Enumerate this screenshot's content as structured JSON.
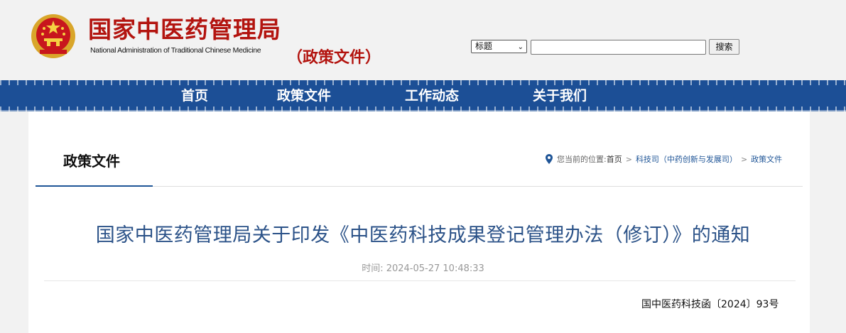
{
  "header": {
    "site_name_cn": "国家中医药管理局",
    "site_name_en": "National Administration of Traditional Chinese Medicine",
    "section_subtitle": "（政策文件）",
    "emblem_icon": "national-emblem-icon",
    "brand_color": "#b3140f"
  },
  "search": {
    "select_value": "标题",
    "input_value": "",
    "button_label": "搜索"
  },
  "nav": {
    "color": "#1c4f96",
    "items": [
      {
        "label": "首页"
      },
      {
        "label": "政策文件"
      },
      {
        "label": "工作动态"
      },
      {
        "label": "关于我们"
      }
    ]
  },
  "section": {
    "title": "政策文件"
  },
  "breadcrumb": {
    "icon": "location-pin-icon",
    "prefix": "您当前的位置:",
    "items": [
      {
        "label": "首页"
      },
      {
        "label": "科技司（中药创新与发展司）"
      },
      {
        "label": "政策文件"
      }
    ],
    "separator": ">"
  },
  "article": {
    "title": "国家中医药管理局关于印发《中医药科技成果登记管理办法（修订）》的通知",
    "time_label": "时间:",
    "time_value": "2024-05-27 10:48:33",
    "doc_number": "国中医药科技函〔2024〕93号",
    "title_color": "#2b5288"
  }
}
